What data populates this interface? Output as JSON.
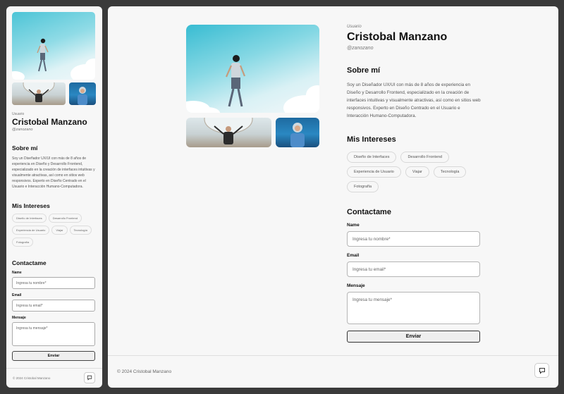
{
  "profile": {
    "label": "Usuario",
    "name": "Cristobal Manzano",
    "handle": "@zanozano"
  },
  "about": {
    "title": "Sobre mí",
    "text": "Soy un Diseñador UX/UI con más de 8 años de experiencia en Diseño y Desarrollo Frontend, especializado en la creación de interfaces intuitivas y visualmente atractivas, así como en sitios web responsivos. Experto en Diseño Centrado en el Usuario e Interacción Humano-Computadora."
  },
  "interests": {
    "title": "Mis Intereses",
    "items": [
      "Diseño de Interfaces",
      "Desarrollo Frontend",
      "Experiencia de Usuario",
      "Viajar",
      "Tecnología",
      "Fotografía"
    ]
  },
  "contact": {
    "title": "Contactame",
    "name_label": "Name",
    "name_placeholder": "Ingresa tu nombre*",
    "email_label": "Email",
    "email_placeholder": "Ingresa tu email*",
    "message_label": "Mensaje",
    "message_placeholder": "Ingresa tu mensaje*",
    "submit_label": "Enviar"
  },
  "footer": {
    "copyright": "© 2024 Cristobal Manzano",
    "feedback_icon": "message-square-icon"
  },
  "colors": {
    "page_bg": "#3a3a3a",
    "panel_bg": "#f7f7f7",
    "sky": "#4cc4d6"
  }
}
